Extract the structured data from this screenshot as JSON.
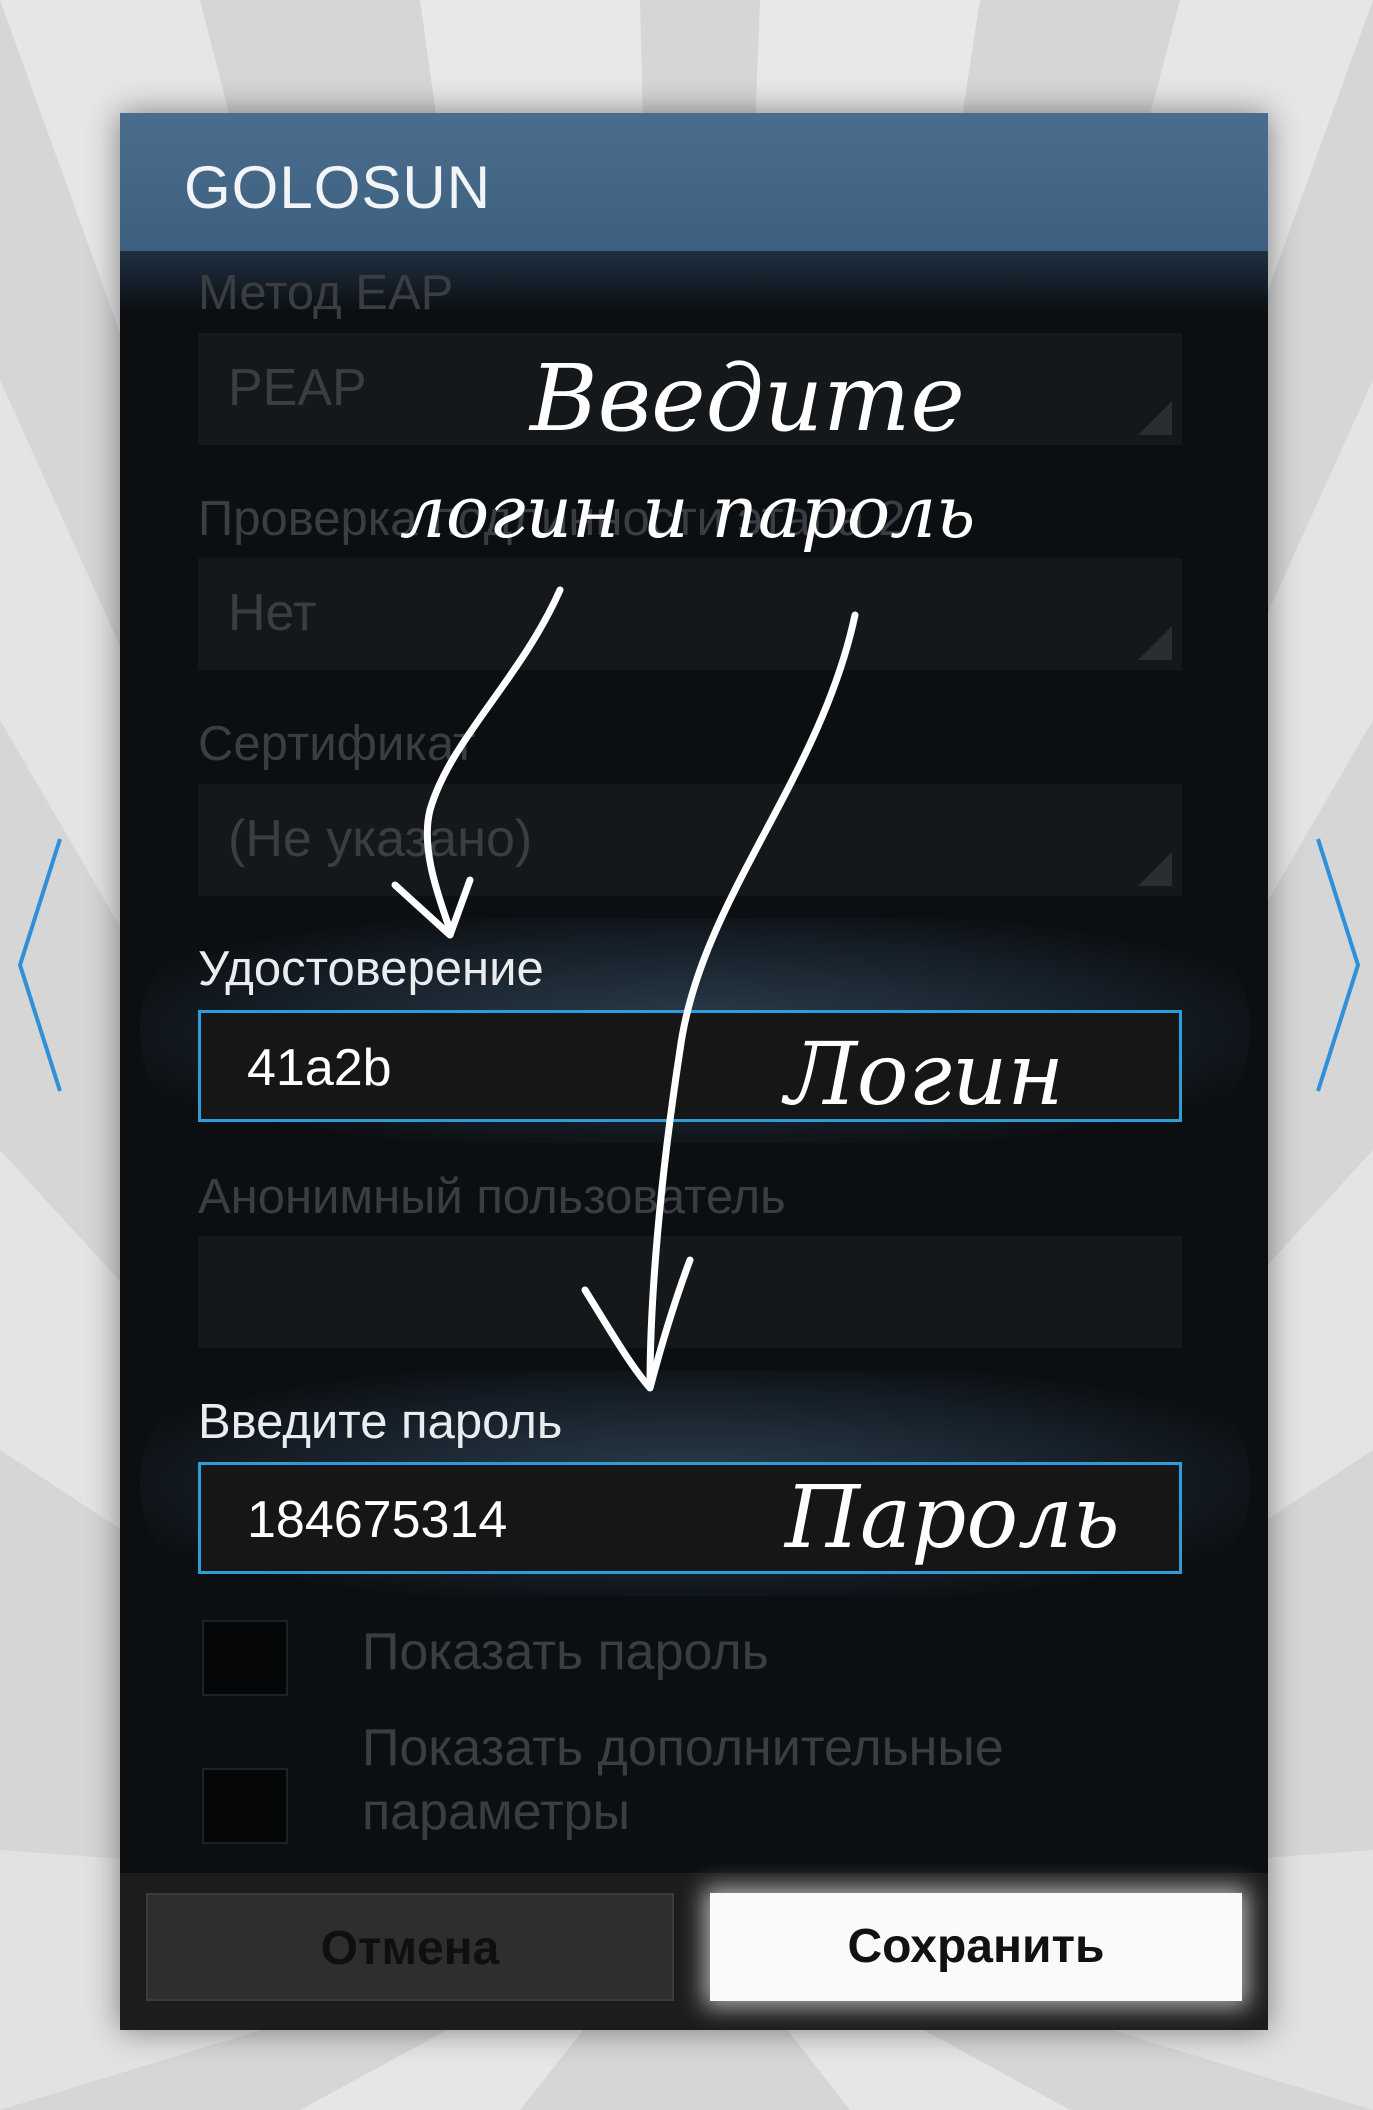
{
  "dialog": {
    "title": "GOLOSUN"
  },
  "fields": {
    "eap_method": {
      "label": "Метод EAP",
      "value": "PEAP"
    },
    "phase2": {
      "label": "Проверка подлинности этапа 2",
      "value": "Нет"
    },
    "certificate": {
      "label": "Сертификат",
      "value": "(Не указано)"
    },
    "identity": {
      "label": "Удостоверение",
      "value": "41a2b"
    },
    "anonymous": {
      "label": "Анонимный пользователь",
      "value": ""
    },
    "password": {
      "label": "Введите пароль",
      "value": "184675314"
    }
  },
  "checkboxes": {
    "show_password": {
      "label": "Показать пароль"
    },
    "show_advanced": {
      "label": "Показать дополнительные параметры"
    }
  },
  "buttons": {
    "cancel": "Отмена",
    "save": "Сохранить"
  },
  "annotations": {
    "line1": "Введите",
    "line2": "логин и пароль",
    "login_tag": "Логин",
    "password_tag": "Пароль"
  },
  "colors": {
    "titlebar": "#4a6d8e",
    "accent_border": "#2e9cd6",
    "nav_arrow": "#2f8fd8"
  },
  "icons": {
    "left_nav": "chevron-left-icon",
    "right_nav": "chevron-right-icon"
  }
}
